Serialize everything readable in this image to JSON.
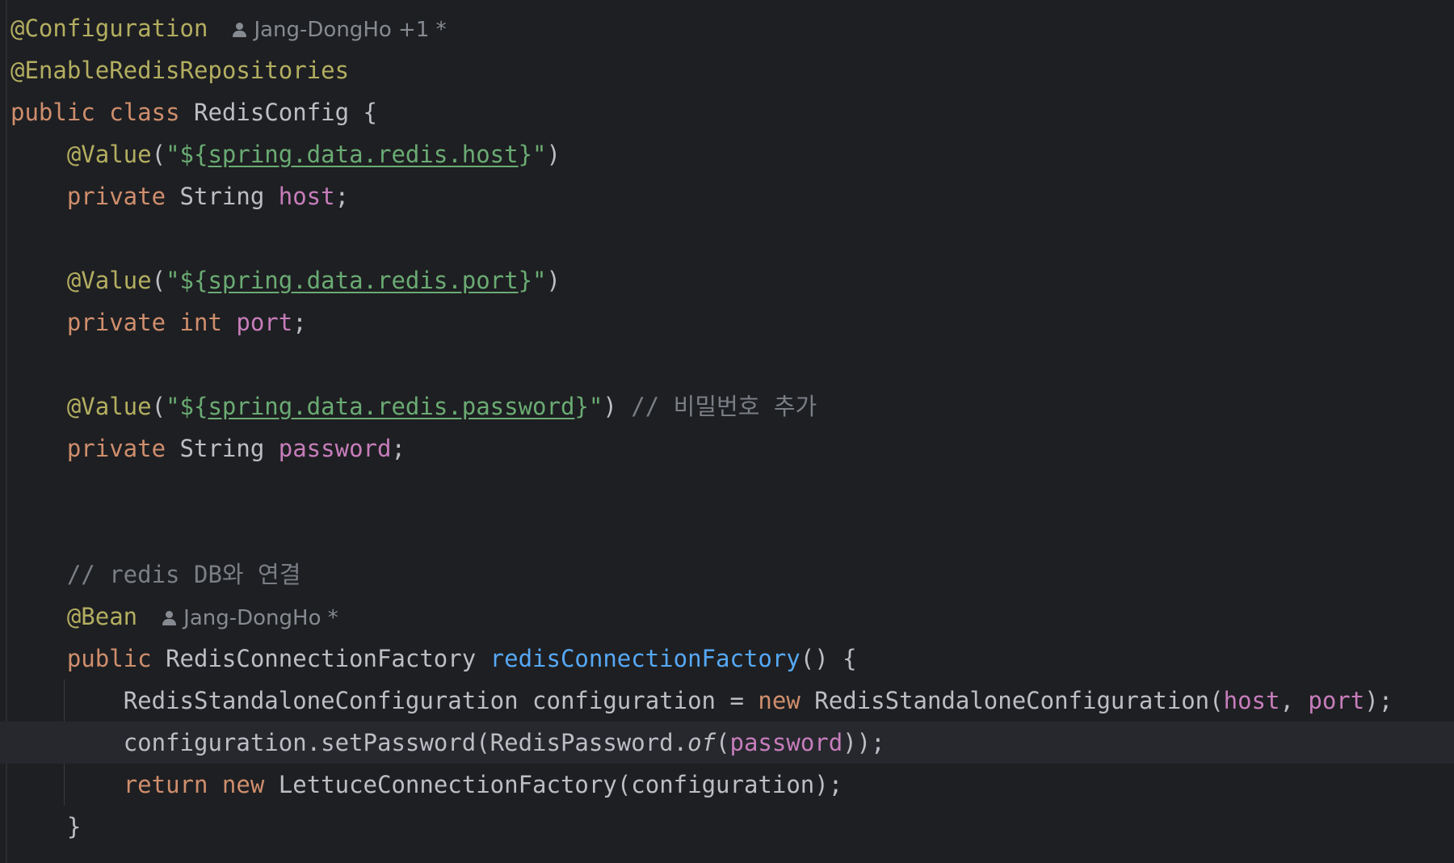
{
  "annotations": {
    "configuration": "@Configuration",
    "enable_redis_repositories": "@EnableRedisRepositories",
    "value": "@Value",
    "bean": "@Bean"
  },
  "authors": {
    "class_author": "Jang-DongHo +1 *",
    "bean_author": "Jang-DongHo *"
  },
  "keywords": {
    "public": "public",
    "class": "class",
    "private": "private",
    "int": "int",
    "new": "new",
    "return": "return"
  },
  "types": {
    "redis_config": "RedisConfig",
    "string": "String",
    "redis_connection_factory": "RedisConnectionFactory",
    "redis_standalone_configuration": "RedisStandaloneConfiguration",
    "redis_password": "RedisPassword",
    "lettuce_connection_factory": "LettuceConnectionFactory"
  },
  "properties": {
    "host": "spring.data.redis.host",
    "port": "spring.data.redis.port",
    "password": "spring.data.redis.password"
  },
  "fields": {
    "host": "host",
    "port": "port",
    "password": "password"
  },
  "methods": {
    "redis_connection_factory": "redisConnectionFactory",
    "set_password": "setPassword",
    "of": "of"
  },
  "locals": {
    "configuration": "configuration"
  },
  "comments": {
    "password_added": "// 비밀번호 추가",
    "redis_db_connect": "// redis DB와 연결"
  },
  "colors": {
    "background": "#1e1f22",
    "current_line": "#26282e",
    "annotation": "#b3ae60",
    "keyword": "#cf8e6d",
    "string": "#6aab73",
    "field": "#c77dbb",
    "method_decl": "#56a8f5",
    "comment": "#7a7e85",
    "text": "#bcbec4",
    "author_hint": "#868a91"
  }
}
